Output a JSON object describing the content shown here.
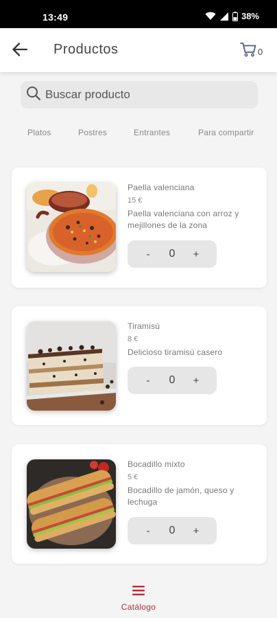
{
  "status_bar": {
    "time": "13:49",
    "battery": "38%"
  },
  "header": {
    "title": "Productos",
    "cart_count": "0"
  },
  "search": {
    "placeholder": "Buscar producto",
    "value": ""
  },
  "categories": [
    "Platos",
    "Postres",
    "Entrantes",
    "Para compartir"
  ],
  "products": [
    {
      "name": "Paella valenciana",
      "price": "15 €",
      "description": "Paella valenciana con arroz y mejillones de la zona",
      "quantity": "0"
    },
    {
      "name": "Tiramisú",
      "price": "8 €",
      "description": "Delicioso tiramisú casero",
      "quantity": "0"
    },
    {
      "name": "Bocadillo mixto",
      "price": "5 €",
      "description": "Bocadillo de jamón, queso y lechuga",
      "quantity": "0"
    }
  ],
  "stepper": {
    "minus": "-",
    "plus": "+"
  },
  "bottom_nav": {
    "label": "Catálogo"
  },
  "colors": {
    "accent": "#b32d3a",
    "background": "#f4f4f4",
    "card": "#ffffff",
    "stepper": "#e6e6e6"
  }
}
